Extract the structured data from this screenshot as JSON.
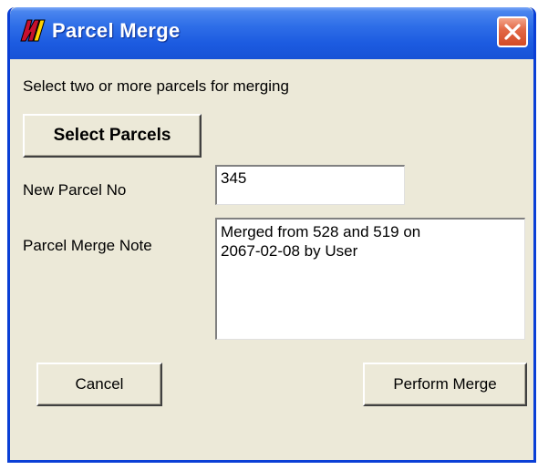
{
  "window": {
    "title": "Parcel Merge"
  },
  "instruction": "Select two or more parcels for merging",
  "buttons": {
    "select_parcels": "Select Parcels",
    "cancel": "Cancel",
    "perform_merge": "Perform Merge"
  },
  "fields": {
    "new_parcel_no": {
      "label": "New Parcel No",
      "value": "345"
    },
    "merge_note": {
      "label": "Parcel Merge Note",
      "value": "Merged from 528 and 519 on\n2067-02-08 by User"
    }
  },
  "icons": {
    "app": "app-logo-icon",
    "close": "close-icon"
  },
  "colors": {
    "titlebar": "#1c5be0",
    "window_bg": "#ece9d8",
    "close_button": "#d24a25"
  }
}
